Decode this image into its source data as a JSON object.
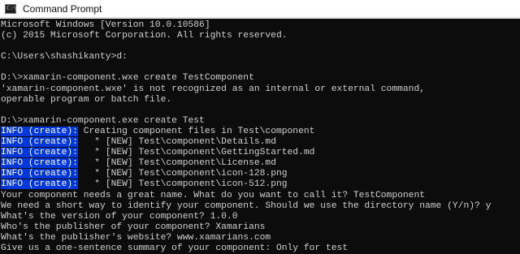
{
  "window": {
    "title": "Command Prompt",
    "icon": "cmd-icon"
  },
  "colors": {
    "console_bg": "#0c0c0c",
    "console_fg": "#d0d0d0",
    "selection_bg": "#0037da"
  },
  "console": {
    "lines": [
      {
        "text": "Microsoft Windows [Version 10.0.10586]"
      },
      {
        "text": "(c) 2015 Microsoft Corporation. All rights reserved."
      },
      {
        "text": ""
      },
      {
        "text": "C:\\Users\\shashikanty>d:"
      },
      {
        "text": ""
      },
      {
        "text": "D:\\>xamarin-component.wxe create TestComponent"
      },
      {
        "text": "'xamarin-component.wxe' is not recognized as an internal or external command,"
      },
      {
        "text": "operable program or batch file."
      },
      {
        "text": ""
      },
      {
        "text": "D:\\>xamarin-component.exe create Test"
      },
      {
        "hl": "INFO (create):",
        "text": " Creating component files in Test\\component"
      },
      {
        "hl": "INFO (create):",
        "text": "   * [NEW] Test\\component\\Details.md"
      },
      {
        "hl": "INFO (create):",
        "text": "   * [NEW] Test\\component\\GettingStarted.md"
      },
      {
        "hl": "INFO (create):",
        "text": "   * [NEW] Test\\component\\License.md"
      },
      {
        "hl": "INFO (create):",
        "text": "   * [NEW] Test\\component\\icon-128.png"
      },
      {
        "hl": "INFO (create):",
        "text": "   * [NEW] Test\\component\\icon-512.png"
      },
      {
        "text": "Your component needs a great name. What do you want to call it? TestComponent"
      },
      {
        "text": "We need a short way to identify your component. Should we use the directory name (Y/n)? y"
      },
      {
        "text": "What's the version of your component? 1.0.0"
      },
      {
        "text": "Who's the publisher of your component? Xamarians"
      },
      {
        "text": "What's the publisher's website? www.xamarians.com"
      },
      {
        "text": "Give us a one-sentence summary of your component: Only for test"
      }
    ]
  }
}
